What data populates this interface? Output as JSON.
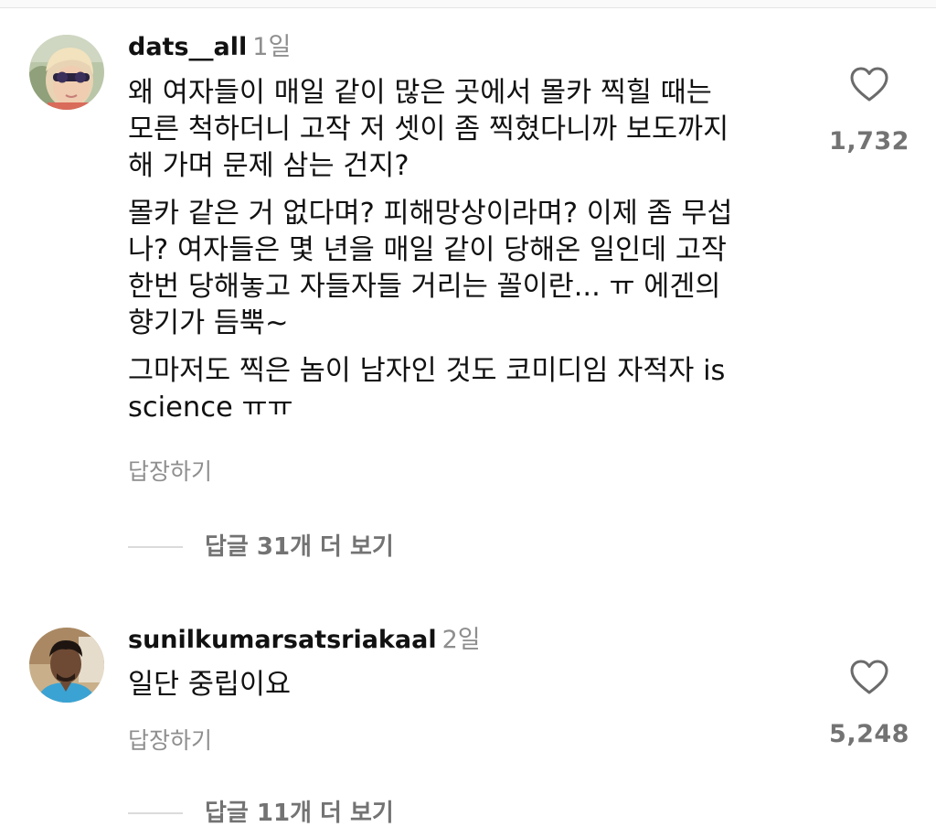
{
  "comments": [
    {
      "username": "dats__all",
      "time": "1일",
      "paragraphs": [
        "왜 여자들이 매일 같이 많은 곳에서 몰카 찍힐 때는\n모른 척하더니 고작 저 셋이 좀 찍혔다니까 보도까지\n해 가며 문제 삼는 건지?",
        "몰카 같은 거 없다며? 피해망상이라며? 이제 좀 무섭\n나? 여자들은 몇 년을 매일 같이 당해온 일인데 고작\n한번 당해놓고 자들자들 거리는 꼴이란... ㅠ 에겐의\n향기가 듬뿍~",
        "그마저도 찍은 놈이 남자인 것도 코미디임 자적자 is\nscience ㅠㅠ"
      ],
      "reply_label": "답장하기",
      "like_count": "1,732",
      "view_replies_label": "답글 31개 더 보기"
    },
    {
      "username": "sunilkumarsatsriakaal",
      "time": "2일",
      "paragraphs": [
        "일단 중립이요"
      ],
      "reply_label": "답장하기",
      "like_count": "5,248",
      "view_replies_label": "답글 11개 더 보기"
    }
  ],
  "icons": {
    "like": "heart-outline-icon"
  },
  "colors": {
    "text": "#111111",
    "secondary": "#8e8e8e",
    "divider": "#dbdbdb"
  }
}
